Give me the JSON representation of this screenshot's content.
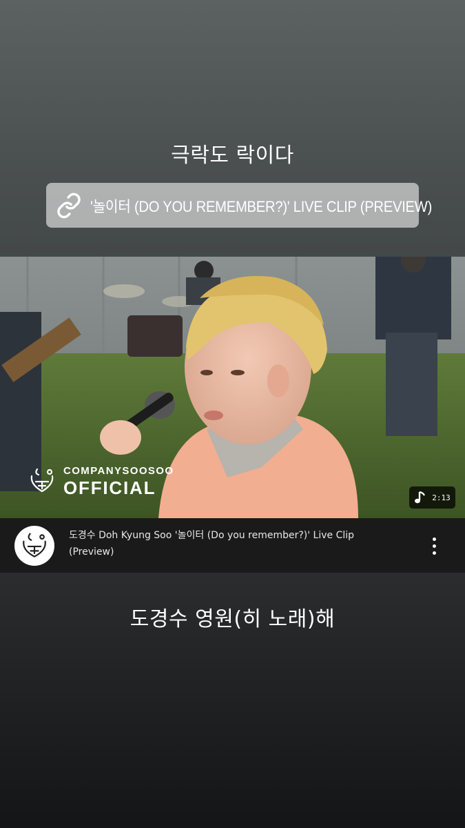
{
  "story": {
    "caption_top": "극락도 락이다",
    "caption_bottom": "도경수 영원(히 노래)해"
  },
  "link_sticker": {
    "icon": "link-icon",
    "text": "'놀이터 (DO YOU REMEMBER?)' LIVE CLIP (PREVIEW)"
  },
  "video": {
    "watermark_line1": "COMPANYSOOSOO",
    "watermark_line2": "OFFICIAL",
    "duration_icon": "music-note-icon",
    "duration": "2:13",
    "title": "도경수 Doh Kyung Soo '놀이터 (Do you remember?)' Live Clip (Preview)",
    "more_icon": "more-vertical-icon"
  },
  "colors": {
    "background_top": "#5c6262",
    "background_bottom": "#141516",
    "sticker_bg": "#cdcdcd",
    "video_info_bg": "#1a1a1a"
  }
}
